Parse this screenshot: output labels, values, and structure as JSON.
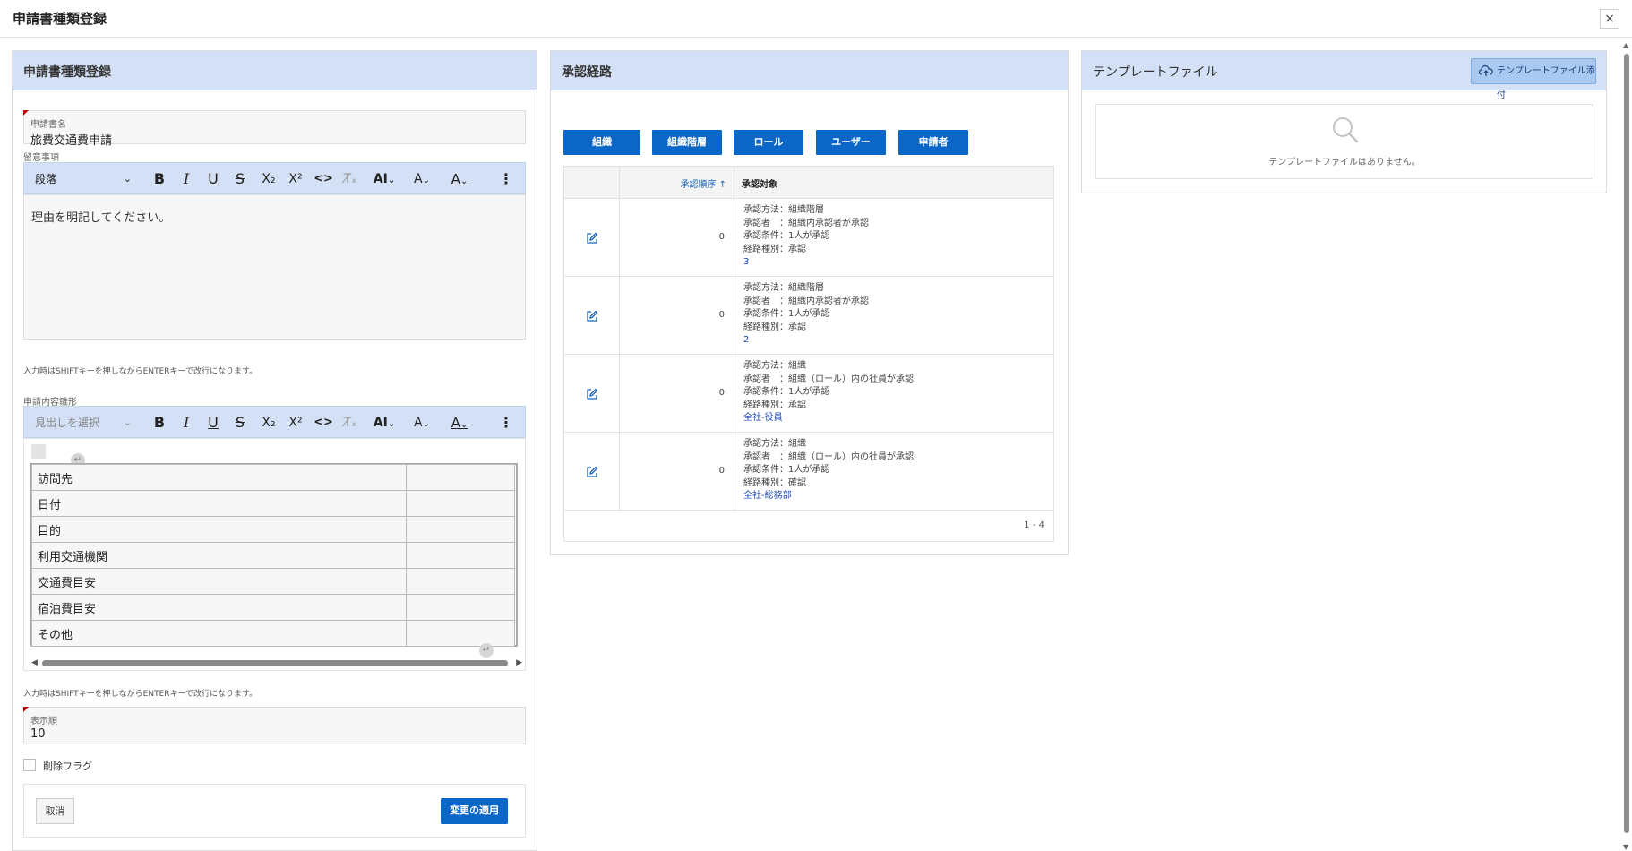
{
  "window": {
    "title": "申請書種類登録",
    "close_glyph": "×"
  },
  "left_panel": {
    "title": "申請書種類登録",
    "name_field": {
      "label": "申請書名",
      "value": "旅費交通費申請"
    },
    "notes": {
      "label": "留意事項",
      "paragraph_select": "段落",
      "content": "理由を明記してください。",
      "hint": "入力時はSHIFTキーを押しながらENTERキーで改行になります。"
    },
    "template": {
      "label": "申請内容雛形",
      "heading_select": "見出しを選択",
      "rows": [
        "訪問先",
        "日付",
        "目的",
        "利用交通機関",
        "交通費目安",
        "宿泊費目安",
        "その他"
      ],
      "hint": "入力時はSHIFTキーを押しながらENTERキーで改行になります。"
    },
    "order_field": {
      "label": "表示順",
      "value": "10"
    },
    "delete_flag": {
      "label": "削除フラグ",
      "checked": false
    },
    "cancel_label": "取消",
    "apply_label": "変更の適用",
    "toolbar": {
      "bold": "B",
      "italic": "I",
      "underline": "U",
      "strike": "S",
      "sub": "X₂",
      "sup": "X²",
      "code": "<>",
      "clear": "T̸ₓ",
      "fontsize": "AI",
      "fontstyle": "A",
      "color": "A",
      "more": "⋮"
    }
  },
  "middle_panel": {
    "title": "承認経路",
    "buttons": [
      "組織",
      "組織階層",
      "ロール",
      "ユーザー",
      "申請者"
    ],
    "header": {
      "order": "承認順序 ↑",
      "target": "承認対象"
    },
    "rows": [
      {
        "order": "0",
        "lines": [
          "承認方法：組織階層",
          "承認者　：組織内承認者が承認",
          "承認条件：1人が承認",
          "経路種別：承認"
        ],
        "link": "3"
      },
      {
        "order": "0",
        "lines": [
          "承認方法：組織階層",
          "承認者　：組織内承認者が承認",
          "承認条件：1人が承認",
          "経路種別：承認"
        ],
        "link": "2"
      },
      {
        "order": "0",
        "lines": [
          "承認方法：組織",
          "承認者　：組織（ロール）内の社員が承認",
          "承認条件：1人が承認",
          "経路種別：承認"
        ],
        "link": "全社-役員"
      },
      {
        "order": "0",
        "lines": [
          "承認方法：組織",
          "承認者　：組織（ロール）内の社員が承認",
          "承認条件：1人が承認",
          "経路種別：確認"
        ],
        "link": "全社-総務部"
      }
    ],
    "pager": "1 - 4"
  },
  "right_panel": {
    "title": "テンプレートファイル",
    "attach_label": "テンプレートファイル添付",
    "empty_text": "テンプレートファイルはありません。"
  },
  "colors": {
    "header_bg": "#d3e0f5",
    "primary": "#0a67c8",
    "link": "#1a47b8",
    "required": "#c00000"
  }
}
